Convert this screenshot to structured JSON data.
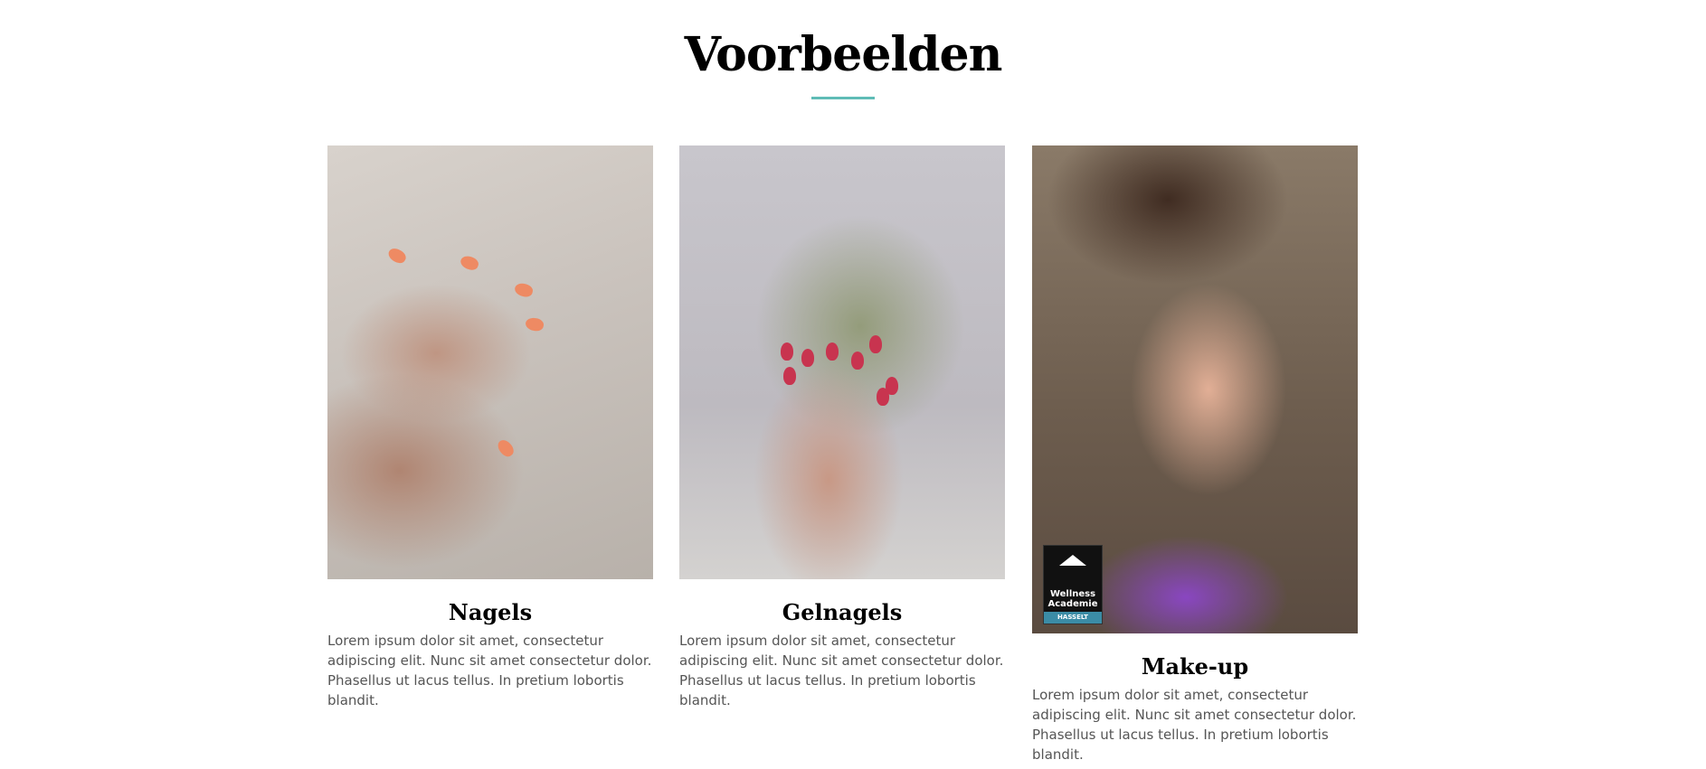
{
  "section": {
    "title": "Voorbeelden",
    "accent_color": "#5fbcb6"
  },
  "cards": [
    {
      "title": "Nagels",
      "text": "Lorem ipsum dolor sit amet, consectetur adipiscing elit. Nunc sit amet consectetur dolor. Phasellus ut lacus tellus. In pretium lobortis blandit.",
      "image": "photo-hand-orange-nails-on-marble"
    },
    {
      "title": "Gelnagels",
      "text": "Lorem ipsum dolor sit amet, consectetur adipiscing elit. Nunc sit amet consectetur dolor. Phasellus ut lacus tellus. In pretium lobortis blandit.",
      "image": "photo-hands-red-gel-nails-with-flowers"
    },
    {
      "title": "Make-up",
      "text": "Lorem ipsum dolor sit amet, consectetur adipiscing elit. Nunc sit amet consectetur dolor. Phasellus ut lacus tellus. In pretium lobortis blandit.",
      "image": "photo-woman-purple-eye-makeup",
      "badge": {
        "line1": "Wellness",
        "line2": "Academie",
        "city": "HASSELT"
      }
    }
  ]
}
